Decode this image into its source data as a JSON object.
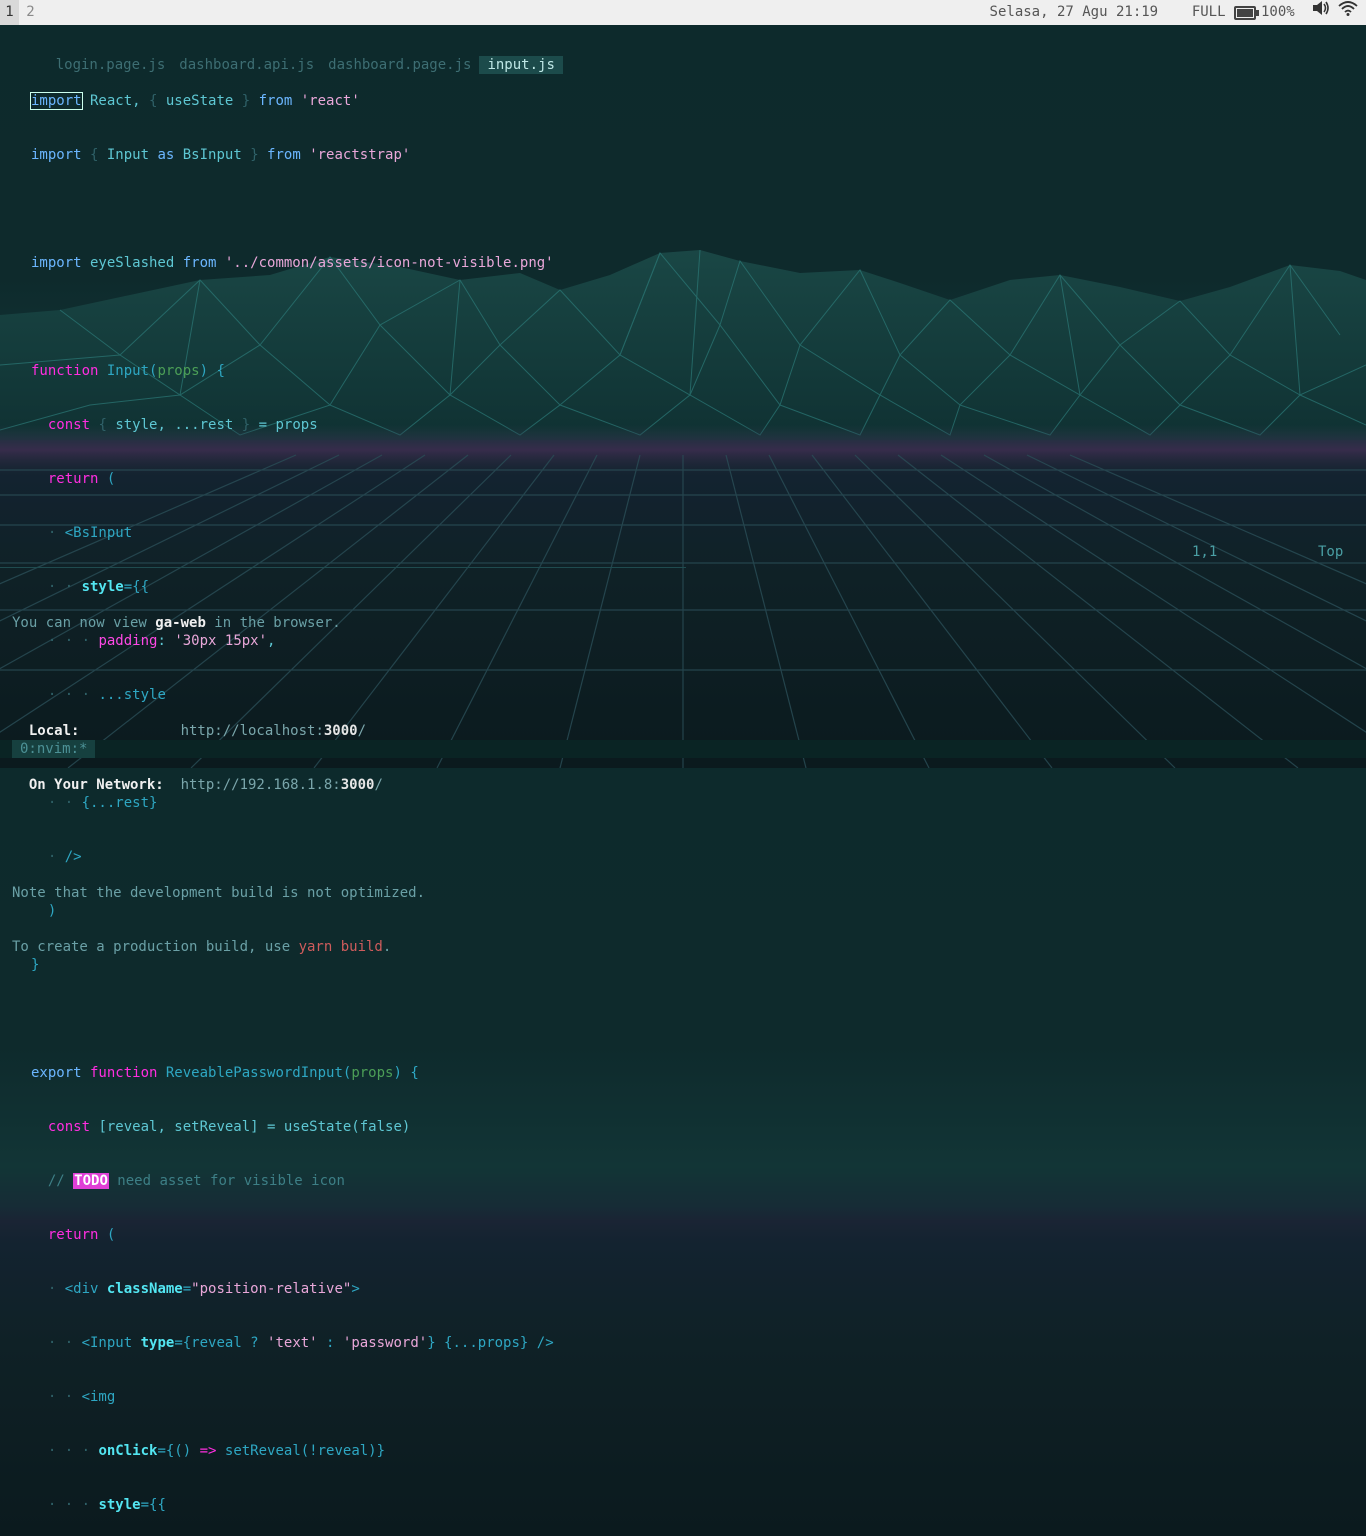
{
  "topbar": {
    "workspaces": [
      "1",
      "2"
    ],
    "datetime": "Selasa, 27 Agu 21:19",
    "mode": "FULL",
    "battery": "100%",
    "battery_level": 1.0,
    "icons": [
      "battery-icon",
      "volume-icon",
      "wifi-icon"
    ]
  },
  "tabs": [
    "login.page.js",
    "dashboard.api.js",
    "dashboard.page.js",
    "input.js"
  ],
  "active_tab": "input.js",
  "code": {
    "l1": {
      "import": "import",
      "react": " React, ",
      "brace1": "{ ",
      "useState": "useState",
      "brace2": " }",
      "from": " from ",
      "str": "'react'"
    },
    "l2": {
      "import": "import",
      "b1": " { ",
      "input": "Input",
      "as": " as ",
      "bs": "BsInput",
      "b2": " }",
      "from": " from ",
      "str": "'reactstrap'"
    },
    "l4": {
      "import": "import",
      "name": " eyeSlashed ",
      "from": "from",
      "str": " '../common/assets/icon-not-visible.png'"
    },
    "l6": {
      "function": "function",
      "name": " Input(",
      "props": "props",
      "rest": ") {"
    },
    "l7": {
      "const": "const",
      "b1": " { ",
      "style": "style, ...rest",
      "b2": " }",
      "eq": " = props"
    },
    "l8": {
      "return": "return",
      "paren": " ("
    },
    "l9": {
      "dot": "· ",
      "tag": "<BsInput"
    },
    "l10": {
      "dot": "· · ",
      "style": "style",
      "eq": "={{"
    },
    "l11": {
      "dot": "· · · ",
      "padding": "padding",
      "colon": ": ",
      "str": "'30px 15px'",
      "comma": ","
    },
    "l12": {
      "dot": "· · · ",
      "spread": "...style"
    },
    "l13": {
      "dot": "· · ",
      "close": "}}"
    },
    "l14": {
      "dot": "· · ",
      "rest": "{...rest}"
    },
    "l15": {
      "dot": "· ",
      "close": "/>"
    },
    "l16": {
      "paren": ")"
    },
    "l17": {
      "brace": "}"
    },
    "l19": {
      "export": "export",
      "function": " function",
      "name": " ReveablePasswordInput(",
      "props": "props",
      "rest": ") {"
    },
    "l20": {
      "const": "const",
      "decl": " [reveal, setReveal] = useState(false)"
    },
    "l21": {
      "slashes": "// ",
      "todo": "TODO",
      "rest": " need asset for visible icon"
    },
    "l22": {
      "return": "return",
      "paren": " ("
    },
    "l23": {
      "dot": "· ",
      "tag": "<div ",
      "attr": "className",
      "eq": "=",
      "str": "\"position-relative\"",
      "close": ">"
    },
    "l24": {
      "dot": "· · ",
      "tag": "<Input ",
      "attr": "type",
      "rest": "={reveal ? ",
      "s1": "'text'",
      "mid": " : ",
      "s2": "'password'",
      "end": "} {...props} />"
    },
    "l25": {
      "dot": "· · ",
      "tag": "<img"
    },
    "l26": {
      "dot": "· · · ",
      "attr": "onClick",
      "rest": "={() ",
      "arrow": "=>",
      "call": " setReveal(!reveal)}"
    },
    "l27": {
      "dot": "· · · ",
      "attr": "style",
      "rest": "={{"
    }
  },
  "ruler": {
    "position": "1,1",
    "scroll": "Top"
  },
  "terminal": {
    "l1": {
      "a": "You can now view ",
      "app": "ga-web",
      "b": " in the browser."
    },
    "local": {
      "label": "  Local:            ",
      "url": "http://localhost:",
      "port": "3000",
      "slash": "/"
    },
    "network": {
      "label": "  On Your Network:  ",
      "url": "http://192.168.1.8:",
      "port": "3000",
      "slash": "/"
    },
    "note1": "Note that the development build is not optimized.",
    "note2a": "To create a production build, use ",
    "yarn": "yarn build",
    "note2b": "."
  },
  "tmux": {
    "window": "0:nvim:*"
  }
}
